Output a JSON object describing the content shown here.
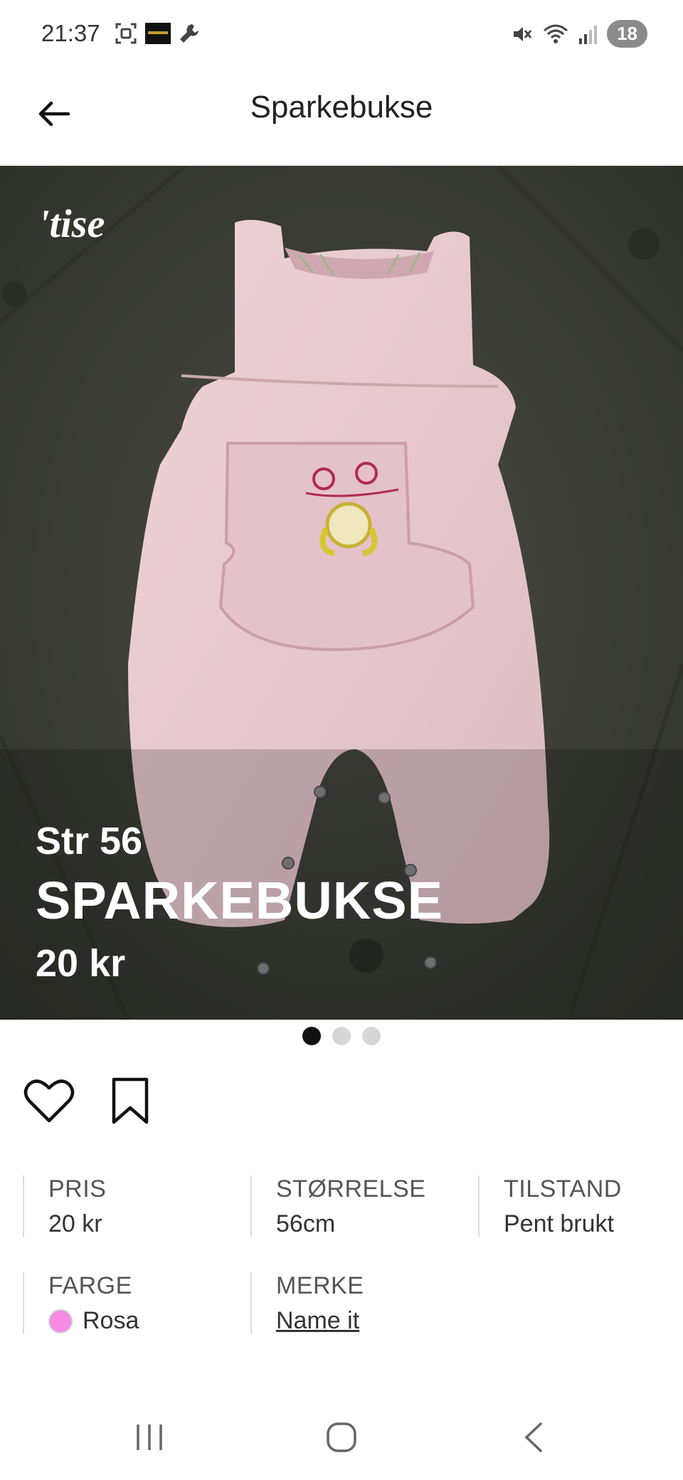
{
  "status": {
    "time": "21:37",
    "battery": "18",
    "icons_left": [
      "screenshot-icon",
      "app-thumbnail-icon",
      "wrench-icon"
    ],
    "icons_right": [
      "mute-icon",
      "wifi-icon",
      "signal-icon"
    ]
  },
  "header": {
    "title": "Sparkebukse",
    "back_icon": "arrow-left-icon"
  },
  "hero": {
    "logo_text": "'tise",
    "overlay_size": "Str 56",
    "overlay_title": "SPARKEBUKSE",
    "overlay_price": "20 kr",
    "photo_subject": "pink baby romper",
    "colors": {
      "background": "#3f4139",
      "garment": "#e8c9cf"
    }
  },
  "carousel": {
    "count": 3,
    "active_index": 0
  },
  "actions": {
    "like_icon": "heart-icon",
    "save_icon": "bookmark-icon"
  },
  "details": {
    "price": {
      "label": "PRIS",
      "value": "20 kr"
    },
    "size": {
      "label": "STØRRELSE",
      "value": "56cm"
    },
    "condition": {
      "label": "TILSTAND",
      "value": "Pent brukt"
    },
    "color": {
      "label": "FARGE",
      "value": "Rosa",
      "swatch": "#f98ae4"
    },
    "brand": {
      "label": "MERKE",
      "value": "Name it"
    }
  },
  "navbar": {
    "recents_icon": "recents-icon",
    "home_icon": "home-icon",
    "back_icon": "back-chevron-icon"
  }
}
